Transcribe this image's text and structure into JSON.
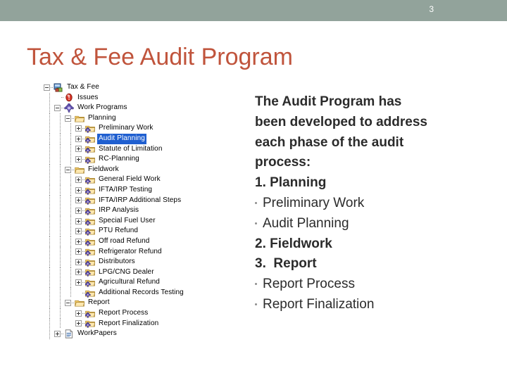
{
  "header": {
    "page_number": "3",
    "bar_color": "#92a39b"
  },
  "title": {
    "text": "Tax & Fee Audit Program",
    "color": "#c0543c"
  },
  "tree": {
    "selected_item": "Audit Planning",
    "selection_color": "#1f5fd0",
    "nodes": [
      {
        "label": "Tax & Fee",
        "depth": 0,
        "icon": "application-icon",
        "expander": "minus"
      },
      {
        "label": "Issues",
        "depth": 1,
        "icon": "issue-alert-icon",
        "expander": "none"
      },
      {
        "label": "Work Programs",
        "depth": 1,
        "icon": "gear-icon",
        "expander": "minus"
      },
      {
        "label": "Planning",
        "depth": 2,
        "icon": "folder-open-icon",
        "expander": "minus"
      },
      {
        "label": "Preliminary Work",
        "depth": 3,
        "icon": "folder-gear-icon",
        "expander": "plus"
      },
      {
        "label": "Audit Planning",
        "depth": 3,
        "icon": "folder-gear-icon",
        "expander": "plus"
      },
      {
        "label": "Statute of Limitation",
        "depth": 3,
        "icon": "folder-gear-icon",
        "expander": "plus"
      },
      {
        "label": "RC-Planning",
        "depth": 3,
        "icon": "folder-gear-icon",
        "expander": "plus"
      },
      {
        "label": "Fieldwork",
        "depth": 2,
        "icon": "folder-open-icon",
        "expander": "minus"
      },
      {
        "label": "General Field Work",
        "depth": 3,
        "icon": "folder-gear-icon",
        "expander": "plus"
      },
      {
        "label": "IFTA/IRP Testing",
        "depth": 3,
        "icon": "folder-gear-icon",
        "expander": "plus"
      },
      {
        "label": "IFTA/IRP Additional Steps",
        "depth": 3,
        "icon": "folder-gear-icon",
        "expander": "plus"
      },
      {
        "label": "IRP Analysis",
        "depth": 3,
        "icon": "folder-gear-icon",
        "expander": "plus"
      },
      {
        "label": "Special Fuel User",
        "depth": 3,
        "icon": "folder-gear-icon",
        "expander": "plus"
      },
      {
        "label": "PTU Refund",
        "depth": 3,
        "icon": "folder-gear-icon",
        "expander": "plus"
      },
      {
        "label": "Off road Refund",
        "depth": 3,
        "icon": "folder-gear-icon",
        "expander": "plus"
      },
      {
        "label": "Refrigerator Refund",
        "depth": 3,
        "icon": "folder-gear-icon",
        "expander": "plus"
      },
      {
        "label": "Distributors",
        "depth": 3,
        "icon": "folder-gear-icon",
        "expander": "plus"
      },
      {
        "label": "LPG/CNG Dealer",
        "depth": 3,
        "icon": "folder-gear-icon",
        "expander": "plus"
      },
      {
        "label": "Agricultural Refund",
        "depth": 3,
        "icon": "folder-gear-icon",
        "expander": "plus"
      },
      {
        "label": "Additional Records Testing",
        "depth": 3,
        "icon": "folder-gear-icon",
        "expander": "none"
      },
      {
        "label": "Report",
        "depth": 2,
        "icon": "folder-open-icon",
        "expander": "minus"
      },
      {
        "label": "Report Process",
        "depth": 3,
        "icon": "folder-gear-icon",
        "expander": "plus"
      },
      {
        "label": "Report Finalization",
        "depth": 3,
        "icon": "folder-gear-icon",
        "expander": "plus"
      },
      {
        "label": "WorkPapers",
        "depth": 1,
        "icon": "document-icon",
        "expander": "plus"
      }
    ]
  },
  "body": {
    "lines": [
      {
        "text": "The Audit Program has",
        "style": "bold"
      },
      {
        "text": "been developed to address",
        "style": "bold"
      },
      {
        "text": "each phase of the audit",
        "style": "bold"
      },
      {
        "text": "process:",
        "style": "bold"
      },
      {
        "text": "1. Planning",
        "style": "bold"
      },
      {
        "text": "Preliminary Work",
        "style": "bullet"
      },
      {
        "text": "Audit Planning",
        "style": "bullet"
      },
      {
        "text": "2. Fieldwork",
        "style": "bold"
      },
      {
        "text": "3.  Report",
        "style": "bold"
      },
      {
        "text": "Report Process",
        "style": "bullet"
      },
      {
        "text": "Report Finalization",
        "style": "bullet"
      }
    ]
  }
}
